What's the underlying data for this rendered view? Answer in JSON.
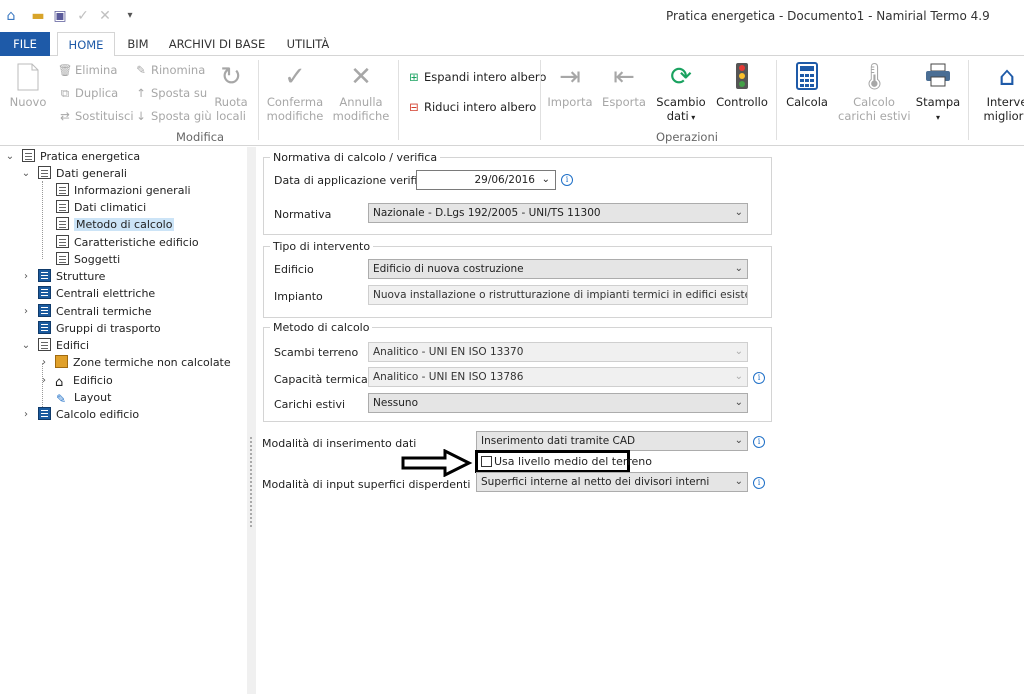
{
  "window": {
    "title": "Pratica energetica - Documento1 - Namirial Termo 4.9"
  },
  "quick_access": {
    "dropdown_glyph": "▾"
  },
  "tabs": [
    {
      "label": "FILE"
    },
    {
      "label": "HOME"
    },
    {
      "label": "BIM"
    },
    {
      "label": "ARCHIVI DI BASE"
    },
    {
      "label": "UTILITÀ"
    }
  ],
  "ribbon": {
    "nuovo": "Nuovo",
    "elimina": "Elimina",
    "duplica": "Duplica",
    "sostituisci": "Sostituisci",
    "rinomina": "Rinomina",
    "sposta_su": "Sposta su",
    "sposta_giu": "Sposta giù",
    "ruota_1": "Ruota",
    "ruota_2": "locali",
    "group_modifica": "Modifica",
    "conferma_1": "Conferma",
    "conferma_2": "modifiche",
    "annulla_1": "Annulla",
    "annulla_2": "modifiche",
    "espandi": "Espandi intero albero",
    "riduci": "Riduci intero albero",
    "importa": "Importa",
    "esporta": "Esporta",
    "scambio_1": "Scambio",
    "scambio_2": "dati",
    "controllo": "Controllo",
    "group_operazioni": "Operazioni",
    "calcola": "Calcola",
    "calcolo_carichi_1": "Calcolo",
    "calcolo_carichi_2": "carichi estivi",
    "stampa": "Stampa",
    "interventi_1": "Interve",
    "interventi_2": "migliora"
  },
  "tree": {
    "root": "Pratica energetica",
    "dati_generali": "Dati generali",
    "informazioni_generali": "Informazioni generali",
    "dati_climatici": "Dati climatici",
    "metodo_di_calcolo": "Metodo di calcolo",
    "caratteristiche_edificio": "Caratteristiche edificio",
    "soggetti": "Soggetti",
    "strutture": "Strutture",
    "centrali_elettriche": "Centrali elettriche",
    "centrali_termiche": "Centrali termiche",
    "gruppi_di_trasporto": "Gruppi di trasporto",
    "edifici": "Edifici",
    "zone_termiche": "Zone termiche non calcolate",
    "edificio": "Edificio",
    "layout": "Layout",
    "calcolo_edificio": "Calcolo edificio"
  },
  "form": {
    "normativa_group": "Normativa di calcolo / verifica",
    "data_label": "Data di applicazione verifiche",
    "data_value": "29/06/2016",
    "normativa_label": "Normativa",
    "normativa_value": "Nazionale - D.Lgs 192/2005 - UNI/TS 11300",
    "tipo_group": "Tipo di intervento",
    "edificio_label": "Edificio",
    "edificio_value": "Edificio di nuova costruzione",
    "impianto_label": "Impianto",
    "impianto_value": "Nuova installazione o ristrutturazione di impianti termici in edifici esistenti",
    "metodo_group": "Metodo di calcolo",
    "scambi_label": "Scambi terreno",
    "scambi_value": "Analitico - UNI EN ISO 13370",
    "capacita_label": "Capacità termica",
    "capacita_value": "Analitico - UNI EN ISO 13786",
    "carichi_label": "Carichi estivi",
    "carichi_value": "Nessuno",
    "modalita_label": "Modalità di inserimento dati",
    "modalita_value": "Inserimento dati tramite CAD",
    "usa_livello_label": "Usa livello medio del terreno",
    "usa_livello_checked": false,
    "input_superfici_label": "Modalità di input superfici disperdenti",
    "input_superfici_value": "Superfici interne al netto dei divisori interni"
  },
  "colors": {
    "accent": "#1e5aa8",
    "selection": "#cce4f7",
    "green": "#1aa260"
  }
}
